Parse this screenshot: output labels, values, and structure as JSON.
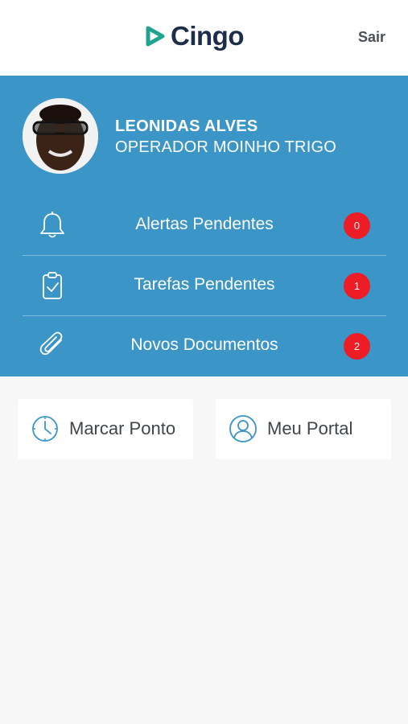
{
  "header": {
    "logo_text": "Cingo",
    "logout_label": "Sair",
    "logo_icon": "play-triangle-icon",
    "brand_accent_color": "#1fa58f"
  },
  "user": {
    "name": "LEONIDAS ALVES",
    "role": "OPERADOR MOINHO TRIGO",
    "avatar": "user-photo"
  },
  "menu": [
    {
      "label": "Alertas Pendentes",
      "count": "0",
      "icon": "bell-icon"
    },
    {
      "label": "Tarefas Pendentes",
      "count": "1",
      "icon": "clipboard-check-icon"
    },
    {
      "label": "Novos Documentos",
      "count": "2",
      "icon": "paperclip-icon"
    }
  ],
  "actions": [
    {
      "label": "Marcar Ponto",
      "icon": "clock-icon"
    },
    {
      "label": "Meu Portal",
      "icon": "user-circle-icon"
    }
  ],
  "colors": {
    "panel": "#3b95c7",
    "badge": "#ee1c25",
    "background": "#f7f7f7",
    "icon_accent": "#3b95c7"
  }
}
